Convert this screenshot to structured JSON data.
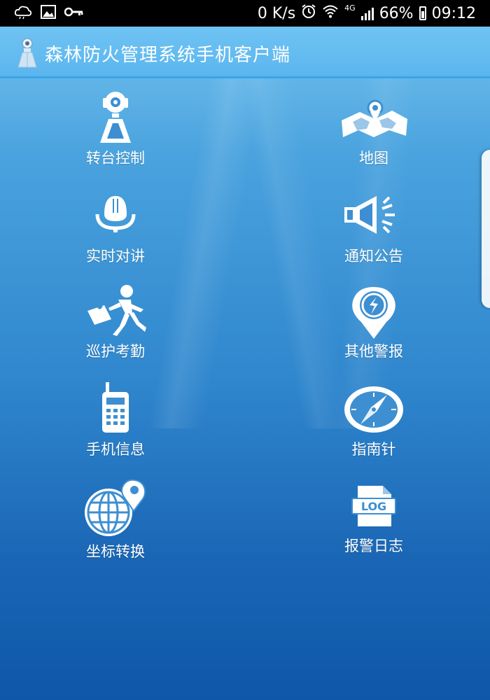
{
  "status_bar": {
    "net_speed": "0 K/s",
    "network_type": "4G",
    "battery": "66%",
    "time": "09:12",
    "icons": [
      "cloud-icon",
      "image-icon",
      "key-icon",
      "alarm-icon",
      "wifi-icon",
      "signal-icon",
      "battery-icon"
    ]
  },
  "header": {
    "title": "森林防火管理系统手机客户端",
    "logo_icon": "camera-tower-icon"
  },
  "menu": {
    "items": [
      {
        "label": "转台控制",
        "icon": "pan-tilt-camera-icon"
      },
      {
        "label": "地图",
        "icon": "map-pin-icon"
      },
      {
        "label": "实时对讲",
        "icon": "microphone-icon"
      },
      {
        "label": "通知公告",
        "icon": "megaphone-icon"
      },
      {
        "label": "巡护考勤",
        "icon": "walking-person-icon"
      },
      {
        "label": "其他警报",
        "icon": "alert-pin-icon"
      },
      {
        "label": "手机信息",
        "icon": "walkie-talkie-icon"
      },
      {
        "label": "指南针",
        "icon": "compass-icon"
      },
      {
        "label": "坐标转换",
        "icon": "globe-pin-icon"
      },
      {
        "label": "报警日志",
        "icon": "log-file-icon"
      }
    ],
    "log_badge": "LOG"
  },
  "colors": {
    "title_bar": "#5bb6ee",
    "background_top": "#79c6f1",
    "background_bottom": "#0f57a8",
    "icon": "#ffffff"
  }
}
